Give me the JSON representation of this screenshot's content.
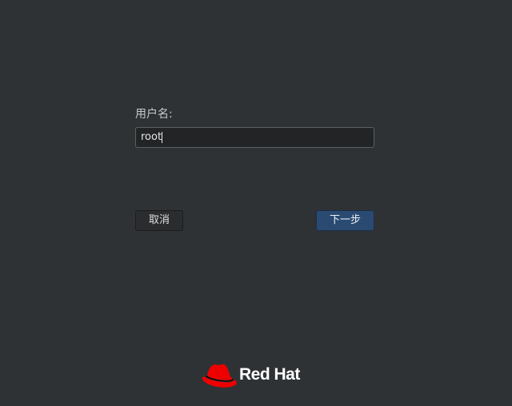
{
  "login": {
    "username_label": "用户名:",
    "username_value": "root"
  },
  "actions": {
    "cancel_label": "取消",
    "next_label": "下一步"
  },
  "branding": {
    "logo_icon": "redhat-fedora-icon",
    "name": "Red Hat"
  },
  "colors": {
    "background": "#2f3235",
    "primary_button": "#2a4a72",
    "brand_red": "#ee0000"
  }
}
